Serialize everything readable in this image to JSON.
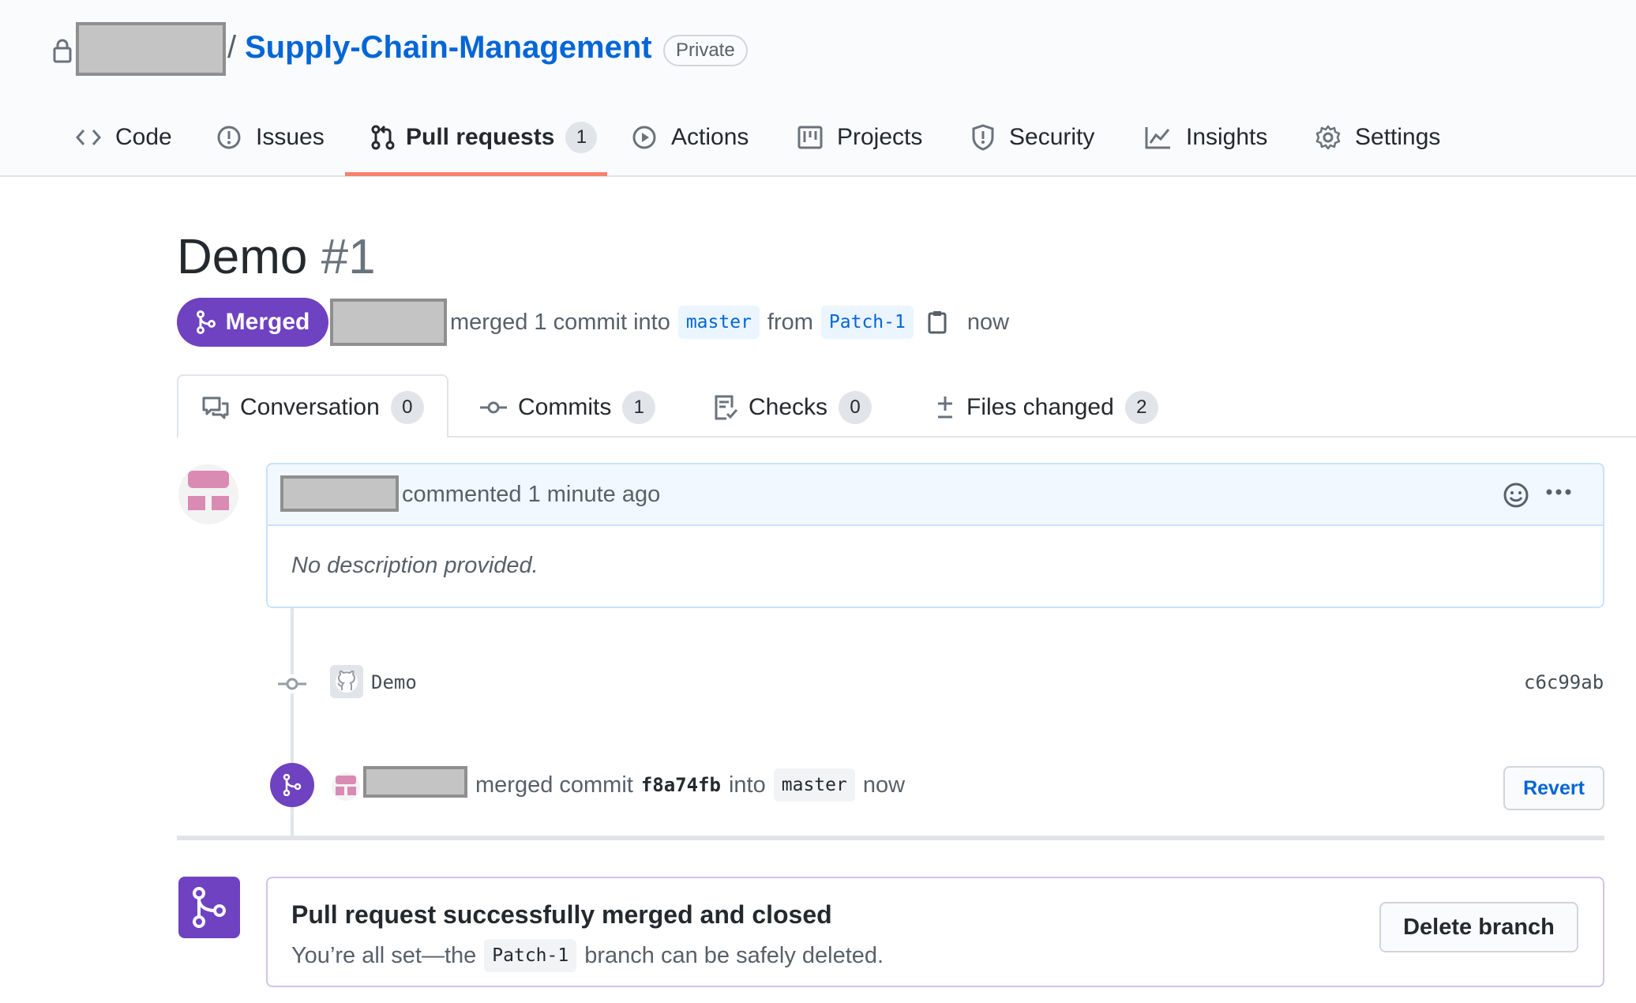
{
  "repo": {
    "name": "Supply-Chain-Management",
    "separator": "/",
    "visibility": "Private"
  },
  "nav": {
    "items": [
      {
        "label": "Code",
        "icon": "code-icon"
      },
      {
        "label": "Issues",
        "icon": "issue-opened-icon"
      },
      {
        "label": "Pull requests",
        "icon": "git-pull-request-icon",
        "count": "1",
        "selected": true
      },
      {
        "label": "Actions",
        "icon": "play-icon"
      },
      {
        "label": "Projects",
        "icon": "project-icon"
      },
      {
        "label": "Security",
        "icon": "shield-icon"
      },
      {
        "label": "Insights",
        "icon": "graph-icon"
      },
      {
        "label": "Settings",
        "icon": "gear-icon"
      }
    ]
  },
  "pr": {
    "title": "Demo",
    "number": "#1",
    "state": "Merged",
    "summary_text": "merged 1 commit into",
    "base_branch": "master",
    "from_text": "from",
    "head_branch": "Patch-1",
    "time": "now"
  },
  "tabs": [
    {
      "label": "Conversation",
      "count": "0",
      "icon": "comment-discussion-icon"
    },
    {
      "label": "Commits",
      "count": "1",
      "icon": "git-commit-icon"
    },
    {
      "label": "Checks",
      "count": "0",
      "icon": "checklist-icon"
    },
    {
      "label": "Files changed",
      "count": "2",
      "icon": "diff-icon"
    }
  ],
  "comment": {
    "action": "commented 1 minute ago",
    "body": "No description provided."
  },
  "commit": {
    "message": "Demo",
    "sha": "c6c99ab"
  },
  "merge_event": {
    "action": "merged commit",
    "sha": "f8a74fb",
    "into_text": "into",
    "branch": "master",
    "time": "now",
    "revert_label": "Revert"
  },
  "merge_status": {
    "title": "Pull request successfully merged and closed",
    "desc_prefix": "You’re all set—the",
    "branch": "Patch-1",
    "desc_suffix": "branch can be safely deleted.",
    "delete_label": "Delete branch"
  },
  "colors": {
    "merged": "#6f42c1",
    "link": "#0366d6",
    "tab_underline": "#f9826c"
  }
}
